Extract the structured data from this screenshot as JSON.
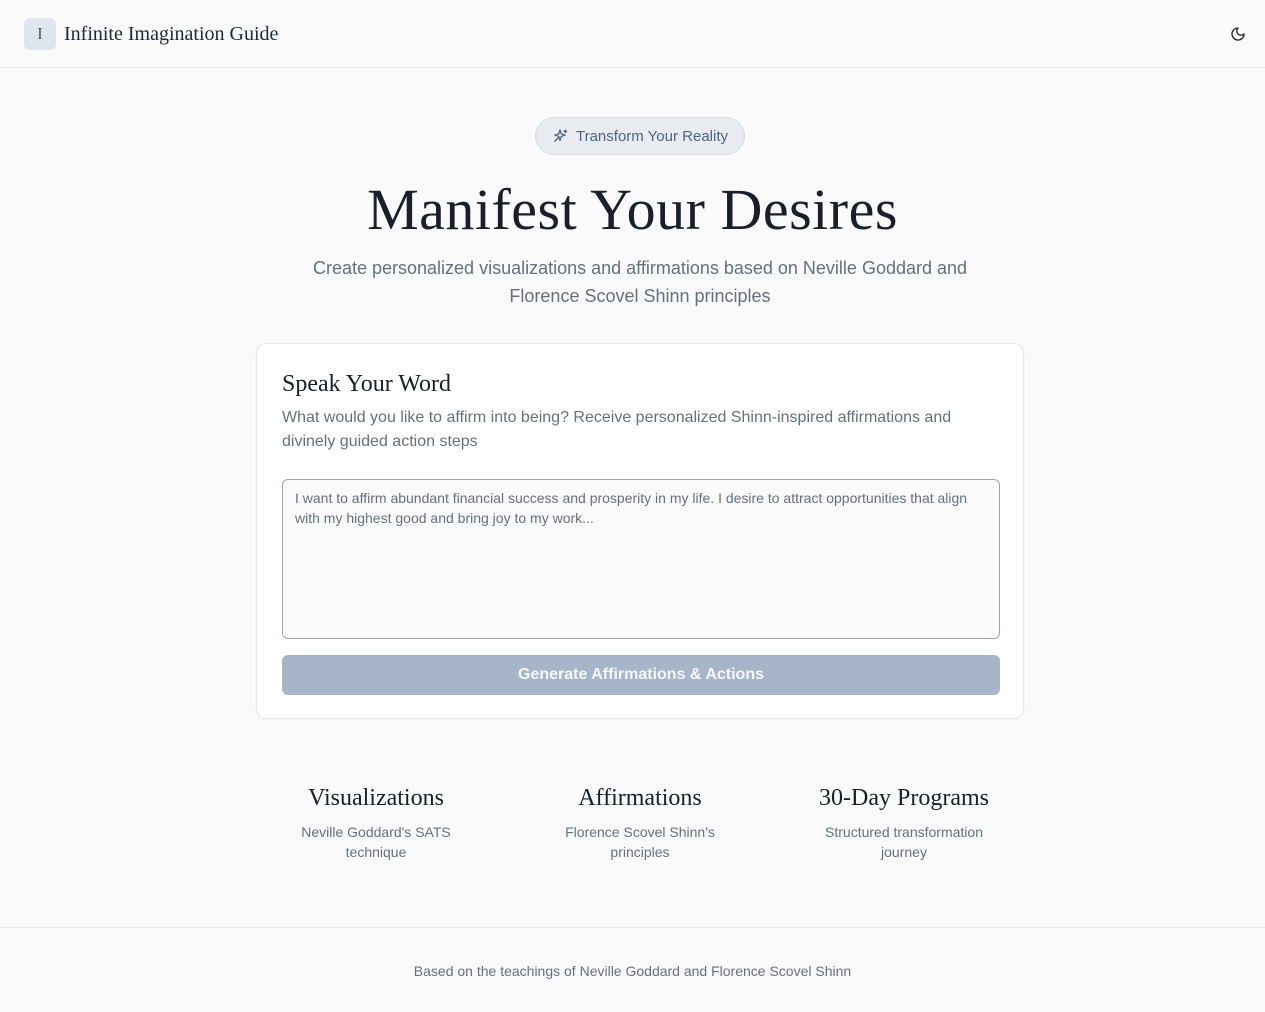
{
  "header": {
    "logo_letter": "I",
    "app_title": "Infinite Imagination Guide",
    "theme_toggle_icon": "moon-icon"
  },
  "hero": {
    "badge_icon": "sparkles-icon",
    "badge_label": "Transform Your Reality",
    "title": "Manifest Your Desires",
    "subtitle": "Create personalized visualizations and affirmations based on Neville Goddard and Florence Scovel Shinn principles"
  },
  "card": {
    "title": "Speak Your Word",
    "description": "What would you like to affirm into being? Receive personalized Shinn-inspired affirmations and divinely guided action steps",
    "input_value": "",
    "input_placeholder": "I want to affirm abundant financial success and prosperity in my life. I desire to attract opportunities that align with my highest good and bring joy to my work...",
    "button_label": "Generate Affirmations & Actions"
  },
  "features": [
    {
      "title": "Visualizations",
      "description": "Neville Goddard's SATS technique"
    },
    {
      "title": "Affirmations",
      "description": "Florence Scovel Shinn's principles"
    },
    {
      "title": "30-Day Programs",
      "description": "Structured transformation journey"
    }
  ],
  "footer": {
    "text": "Based on the teachings of Neville Goddard and Florence Scovel Shinn"
  },
  "colors": {
    "accent": "#4a6585",
    "button_disabled": "#a6b6c8",
    "background": "#fafafa"
  }
}
